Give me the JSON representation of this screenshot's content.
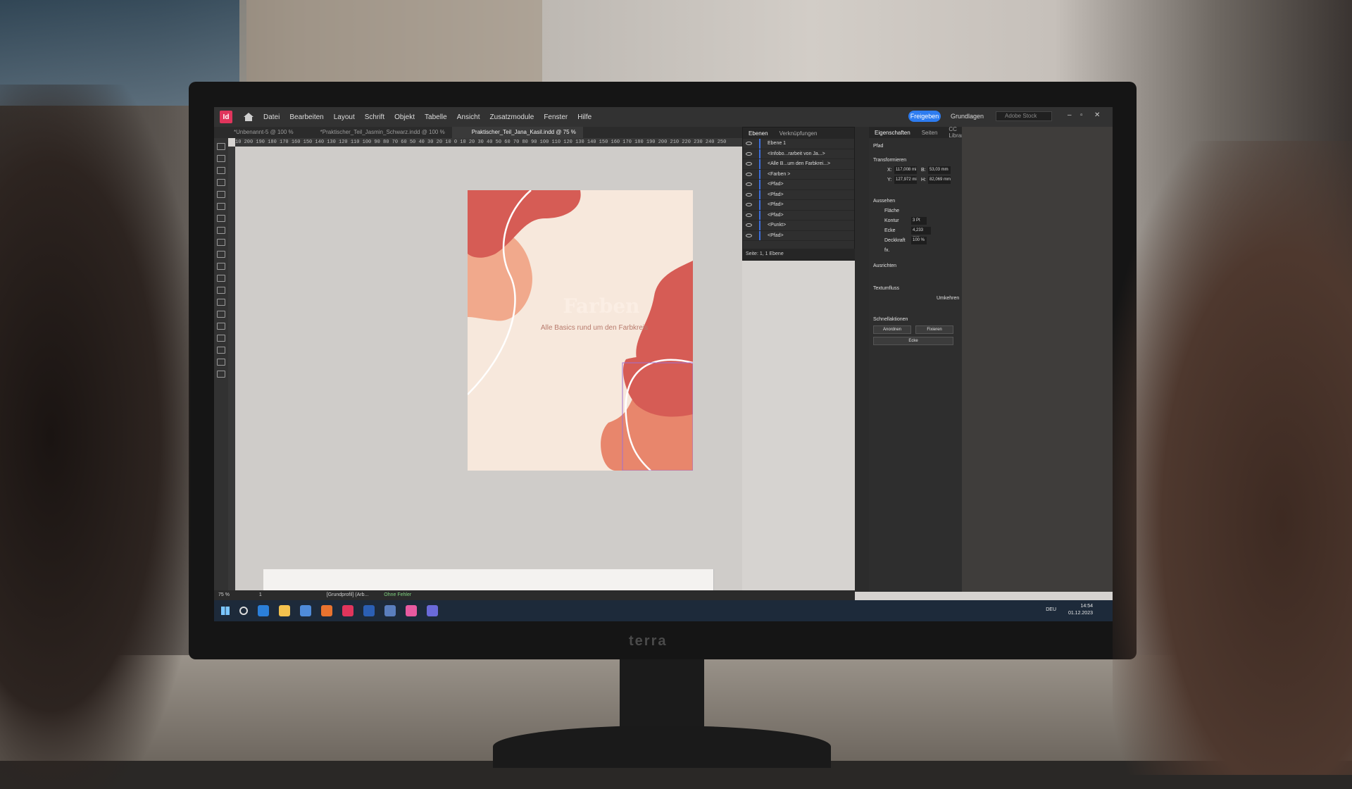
{
  "app": {
    "logo_text": "Id",
    "menu": [
      "Datei",
      "Bearbeiten",
      "Layout",
      "Schrift",
      "Objekt",
      "Tabelle",
      "Ansicht",
      "Zusatzmodule",
      "Fenster",
      "Hilfe"
    ],
    "share_label": "Freigeben",
    "workspace_label": "Grundlagen",
    "search_placeholder": "Adobe Stock"
  },
  "tabs": [
    {
      "label": "*Unbenannt-5 @ 100 %",
      "active": false
    },
    {
      "label": "*Praktischer_Teil_Jasmin_Schwarz.indd @ 100 %",
      "active": false
    },
    {
      "label": "Praktischer_Teil_Jana_Kasil.indd @ 75 %",
      "active": true
    }
  ],
  "ruler_labels": "10 200 190 180 170 160 150 140 130 120 110 100 90 80 70 60 50 40 30 20 10 0 10 20 30 40 50 60 70 80 90 100 110 120 130 140 150 160 170 180 190 200 210 220 230 240 250",
  "artboard": {
    "title": "Farben",
    "subtitle": "Alle Basics rund um den Farbkreis",
    "colors": {
      "background": "#f7e8dc",
      "dark": "#d65c55",
      "mid": "#e8866c",
      "light": "#f1a98c",
      "line": "#ffffff"
    }
  },
  "layers_panel": {
    "tabs": [
      "Ebenen",
      "Verknüpfungen"
    ],
    "layer_name": "Ebene 1",
    "items": [
      "<Infobo...rarbeit von Ja...>",
      "<Alle B...um den Farbkrei...>",
      "<Farben >",
      "<Pfad>",
      "<Pfad>",
      "<Pfad>",
      "<Pfad>",
      "<Punkt>",
      "<Pfad>",
      "<Pfad>"
    ],
    "footer": "Seite: 1, 1 Ebene"
  },
  "properties_panel": {
    "tabs": [
      "Eigenschaften",
      "Seiten",
      "CC Libraries"
    ],
    "object_type": "Pfad",
    "transform_title": "Transformieren",
    "x_label": "X:",
    "x_value": "117,008 mi",
    "y_label": "Y:",
    "y_value": "127,972 mi",
    "w_label": "B:",
    "w_value": "53,03 mm",
    "h_label": "H:",
    "h_value": "82,069 mm",
    "appearance_title": "Aussehen",
    "fill_label": "Fläche",
    "stroke_label": "Kontur",
    "stroke_weight": "3 Pt",
    "corner_label": "Ecke",
    "corner_value": "4,233 mm",
    "opacity_label": "Deckkraft",
    "opacity_value": "100 %",
    "fx_label": "fx.",
    "align_title": "Ausrichten",
    "textwrap_title": "Textumfluss",
    "wrap_option": "Umkehren",
    "quick_title": "Schnellaktionen",
    "quick_buttons": [
      "Anordnen",
      "Fixieren"
    ],
    "corner_button": "Ecke"
  },
  "statusbar": {
    "zoom": "75 %",
    "page": "1",
    "profile": "[Grundprofil] (Arb...",
    "errors": "Ohne Fehler"
  },
  "taskbar": {
    "language": "DEU",
    "time": "14:54",
    "date": "01.12.2023",
    "app_colors": [
      "#2b7fd9",
      "#f2c14e",
      "#4f8bd9",
      "#e8732f",
      "#e0355c",
      "#2b5fb4",
      "#5a7ebd",
      "#e85aa0",
      "#6a6ad9"
    ]
  },
  "monitor_brand": "terra"
}
